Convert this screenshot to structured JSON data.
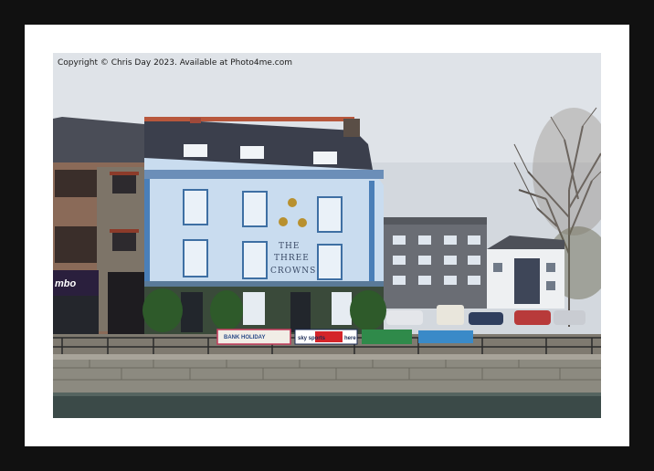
{
  "image": {
    "copyright": "Copyright © Chris Day 2023. Available at Photo4me.com",
    "pub_name_line1": "THE",
    "pub_name_line2": "THREE",
    "pub_name_line3": "CROWNS",
    "shop_sign": "mbo",
    "banner_holiday": "BANK HOLIDAY",
    "banner_sky": "sky sports",
    "banner_sky_small": "here"
  },
  "colors": {
    "frame": "#111111",
    "mount": "#ffffff",
    "sky": "#d6dbe0",
    "pub_facade": "#c9dcef",
    "pub_trim": "#4a7fb8",
    "roof": "#3b3f4c",
    "water": "#3b4a48",
    "quay_wall": "#8c8a80"
  }
}
